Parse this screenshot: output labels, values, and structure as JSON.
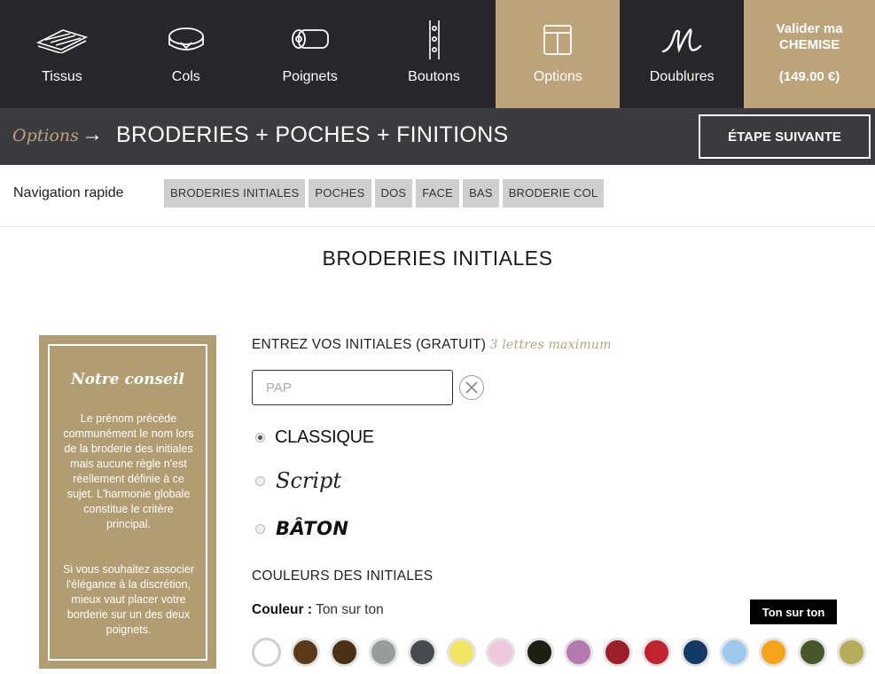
{
  "nav": {
    "items": [
      {
        "label": "Tissus",
        "icon": "fabric-icon"
      },
      {
        "label": "Cols",
        "icon": "collar-icon"
      },
      {
        "label": "Poignets",
        "icon": "cuff-icon"
      },
      {
        "label": "Boutons",
        "icon": "buttons-icon"
      },
      {
        "label": "Options",
        "icon": "shirt-option-icon",
        "active": true
      },
      {
        "label": "Doublures",
        "icon": "monogram-icon"
      }
    ],
    "cta_line1": "Valider ma",
    "cta_line2": "CHEMISE",
    "cta_price": "(149.00 €)"
  },
  "step": {
    "category": "Options",
    "arrow": "→",
    "title": "BRODERIES + POCHES + FINITIONS",
    "next_label": "ÉTAPE SUIVANTE"
  },
  "quicknav": {
    "label": "Navigation rapide",
    "tabs": [
      "BRODERIES INITIALES",
      "POCHES",
      "DOS",
      "FACE",
      "BAS",
      "BRODERIE COL"
    ]
  },
  "section_title": "BRODERIES INITIALES",
  "advice": {
    "title": "Notre conseil",
    "p1": "Le prénom précède communément le nom lors de la broderie des initiales mais aucune règle n'est réellement définie à ce sujet. L'harmonie globale constitue le critère principal.",
    "p2": "Si vous souhaitez associer l'élégance à la discrétion, mieux vaut placer votre borderie sur un des deux poignets."
  },
  "initials": {
    "label": "ENTREZ VOS INITIALES (GRATUIT)",
    "hint": "3 lettres maximum",
    "placeholder": "PAP",
    "value": ""
  },
  "fonts": [
    {
      "label": "CLASSIQUE",
      "selected": true
    },
    {
      "label": "Script",
      "selected": false
    },
    {
      "label": "BÂTON",
      "selected": false
    }
  ],
  "colors": {
    "title": "COULEURS DES INITIALES",
    "label": "Couleur :",
    "current": "Ton sur ton",
    "tooltip": "Ton sur ton",
    "swatches": [
      "#ffffff",
      "#5a3a17",
      "#4a3015",
      "#9a9c9b",
      "#484a50",
      "#f1e564",
      "#efc8dc",
      "#1c1d13",
      "#b47ab0",
      "#9a1f2a",
      "#c02430",
      "#163a66",
      "#9cc9ec",
      "#f5a51a",
      "#48562a",
      "#b6ad5a"
    ]
  }
}
